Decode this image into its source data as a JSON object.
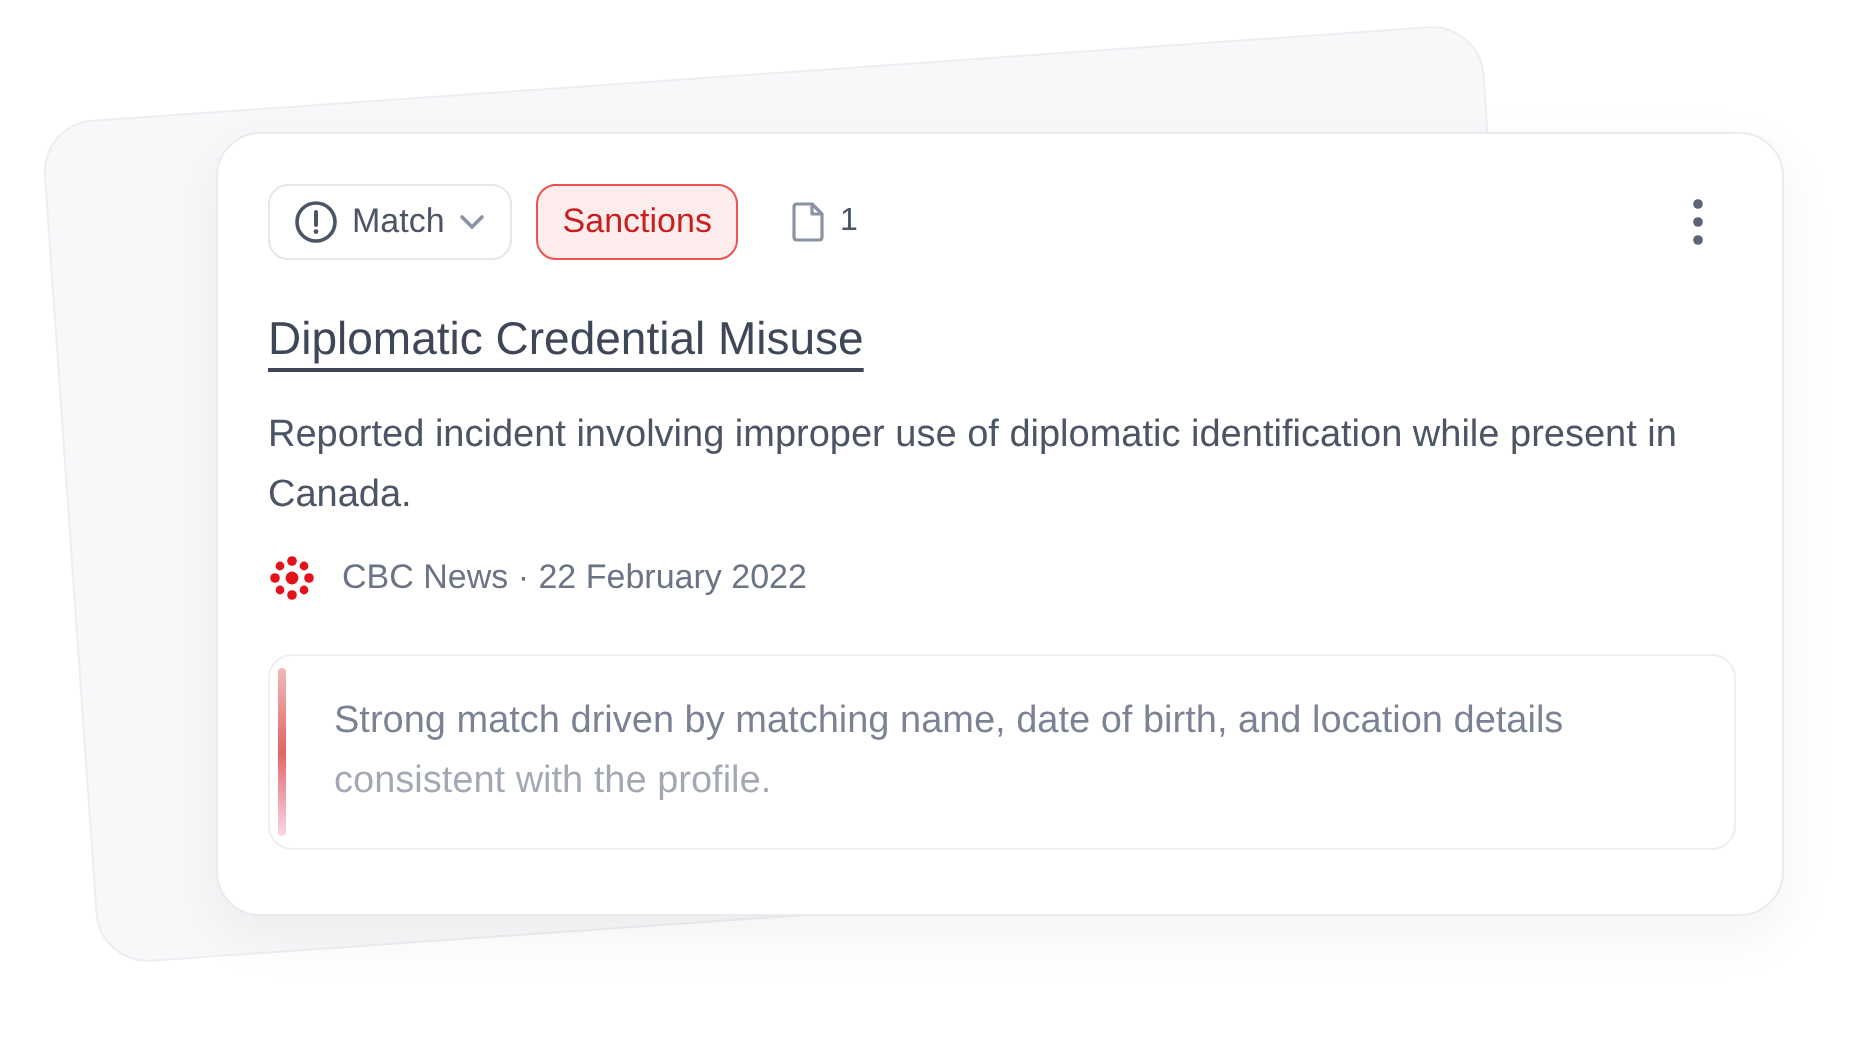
{
  "status": {
    "label": "Match"
  },
  "tag": {
    "label": "Sanctions"
  },
  "documents": {
    "count": "1"
  },
  "title": "Diplomatic Credential Misuse",
  "description": "Reported incident involving improper use of diplomatic identification while present in Canada.",
  "source": {
    "name": "CBC News · 22 February 2022"
  },
  "explanation": "Strong match driven by matching name, date of birth, and location details consistent with the profile."
}
